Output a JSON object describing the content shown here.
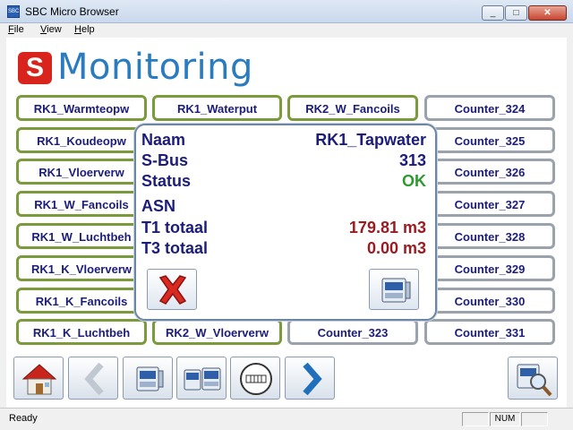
{
  "window": {
    "title": "SBC Micro Browser",
    "minimize": "_",
    "maximize": "□",
    "close": "✕",
    "app_icon_text": "SBC"
  },
  "menu": [
    "File",
    "View",
    "Help"
  ],
  "logo": {
    "letter": "S",
    "text": "Monitoring"
  },
  "tiles": {
    "col1": [
      "RK1_Warmteopw",
      "RK1_Koudeopw",
      "RK1_Vloerverw",
      "RK1_W_Fancoils",
      "RK1_W_Luchtbeh",
      "RK1_K_Vloerverw",
      "RK1_K_Fancoils",
      "RK1_K_Luchtbeh"
    ],
    "col2": [
      "RK1_Waterput",
      "RK2_W_Vloerverw"
    ],
    "col3": [
      "RK2_W_Fancoils",
      "Counter_323"
    ],
    "col4": [
      "Counter_324",
      "Counter_325",
      "Counter_326",
      "Counter_327",
      "Counter_328",
      "Counter_329",
      "Counter_330",
      "Counter_331"
    ]
  },
  "popup": {
    "naam_label": "Naam",
    "naam_value": "RK1_Tapwater",
    "sbus_label": "S-Bus",
    "sbus_value": "313",
    "status_label": "Status",
    "status_value": "OK",
    "asn_label": "ASN",
    "asn_value": "",
    "t1_label": "T1 totaal",
    "t1_value": "179.81 m3",
    "t3_label": "T3 totaal",
    "t3_value": "0.00 m3"
  },
  "colors": {
    "accent_blue": "#2a7cc0",
    "logo_red": "#d8241c",
    "tile_text": "#1c1c7a",
    "ok_green": "#2e9a2e",
    "value_red": "#9b1b22"
  },
  "toolbar": [
    "home-icon",
    "back-arrow-icon",
    "device-icon",
    "devices-icon",
    "counter-icon",
    "forward-arrow-icon",
    "device-search-icon"
  ],
  "status": {
    "text": "Ready",
    "num": "NUM"
  }
}
